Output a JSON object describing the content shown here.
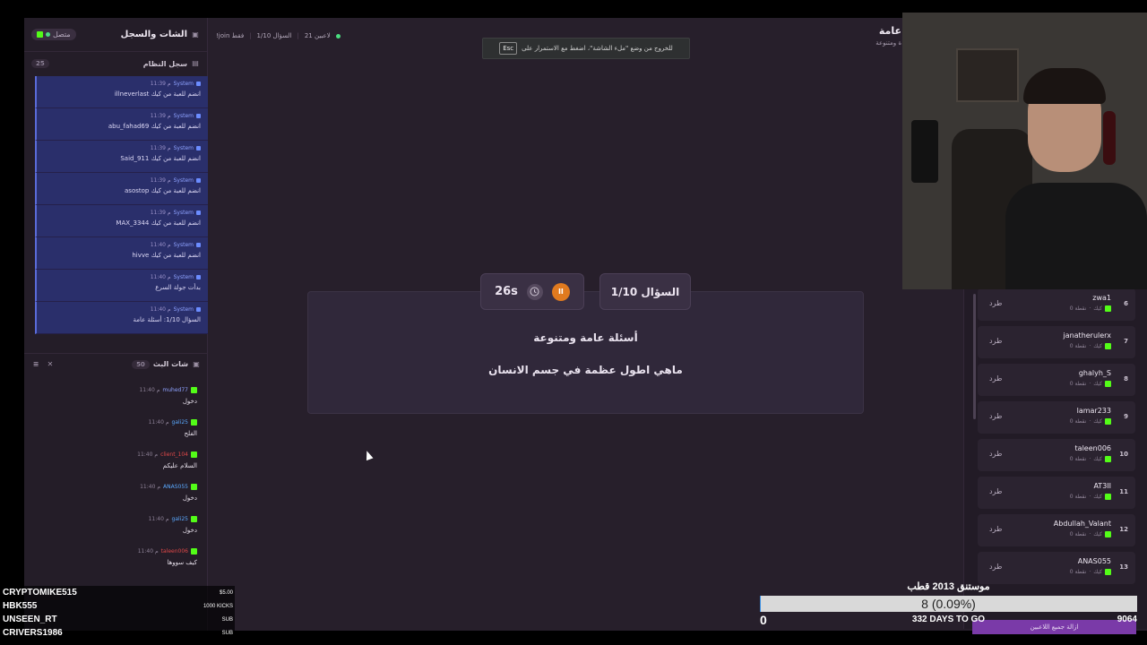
{
  "sidebar": {
    "title": "الشات والسجل",
    "online": "متصل",
    "syslog_title": "سجل النظام",
    "syslog_count": "25",
    "sys_items": [
      {
        "user": "System",
        "time": "11:39 م",
        "msg": "illneverlast انضم للعبة من كيك"
      },
      {
        "user": "System",
        "time": "11:39 م",
        "msg": "abu_fahad69 انضم للعبة من كيك"
      },
      {
        "user": "System",
        "time": "11:39 م",
        "msg": "Said_911 انضم للعبة من كيك"
      },
      {
        "user": "System",
        "time": "11:39 م",
        "msg": "asostop انضم للعبة من كيك"
      },
      {
        "user": "System",
        "time": "11:39 م",
        "msg": "MAX_3344 انضم للعبة من كيك"
      },
      {
        "user": "System",
        "time": "11:40 م",
        "msg": "hivve انضم للعبة من كيك"
      },
      {
        "user": "System",
        "time": "11:40 م",
        "msg": "بدأت جولة السرع"
      },
      {
        "user": "System",
        "time": "11:40 م",
        "msg": "السؤال 1/10: أسئلة عامة"
      }
    ],
    "chat_title": "شات البث",
    "chat_count": "50",
    "chat_items": [
      {
        "user": "muhed77",
        "time": "11:40 م",
        "msg": "دخول",
        "color": "#8ea2ff"
      },
      {
        "user": "gali25",
        "time": "11:40 م",
        "msg": "الفلح",
        "color": "#5aa9ff"
      },
      {
        "user": "client_104",
        "time": "11:40 م",
        "msg": "السلام عليكم",
        "color": "#e04848"
      },
      {
        "user": "ANAS055",
        "time": "11:40 م",
        "msg": "دخول",
        "color": "#5aa9ff"
      },
      {
        "user": "gali25",
        "time": "11:40 م",
        "msg": "دخول",
        "color": "#5aa9ff"
      },
      {
        "user": "taleen006",
        "time": "11:40 م",
        "msg": "كيف سووها",
        "color": "#e04848"
      }
    ]
  },
  "topbar": {
    "players": "21 لاعبين",
    "question": "السؤال 1/10",
    "join_only": "!join فقط",
    "room_title": "عامة",
    "room_subtitle": "ة ومتنوعة",
    "fs_banner": "للخروج من وضع \"ملء الشاشة\"، اضغط مع الاستمرار على",
    "esc": "Esc"
  },
  "question": {
    "timer": "26s",
    "counter": "السؤال 1/10",
    "category": "أسئلة عامة ومتنوعة",
    "text": "ماهي اطول عظمة في جسم الانسان"
  },
  "players": {
    "kick_label": "طرد",
    "sub_label": "كيك",
    "points_label": "0 نقطة",
    "rows": [
      {
        "rank": "6",
        "name": "zwa1"
      },
      {
        "rank": "7",
        "name": "janatherulerx"
      },
      {
        "rank": "8",
        "name": "ghalyh_S"
      },
      {
        "rank": "9",
        "name": "lamar233"
      },
      {
        "rank": "10",
        "name": "taleen006"
      },
      {
        "rank": "11",
        "name": "AT3II"
      },
      {
        "rank": "12",
        "name": "Abdullah_Valant"
      },
      {
        "rank": "13",
        "name": "ANAS055"
      }
    ],
    "remove_all": "ازالة جميع اللاعبين"
  },
  "overlay": {
    "donors": [
      {
        "name": "CRYPTOMIKE515",
        "amount": "$5.00"
      },
      {
        "name": "HBK555",
        "amount": "1000 KICKS"
      },
      {
        "name": "UNSEEN_RT",
        "amount": "SUB"
      },
      {
        "name": "CRIVERS1986",
        "amount": "SUB"
      }
    ],
    "goal_title": "موستنق 2013 قطب",
    "goal_value": "8 (0.09%)",
    "goal_progress": 0.0009,
    "goal_left": "0",
    "goal_days": "332 DAYS TO GO",
    "goal_right": "9064"
  },
  "colors": {
    "accent": "#e07a1f",
    "kick_green": "#53fc18",
    "system_blue": "#2a2f6b"
  }
}
